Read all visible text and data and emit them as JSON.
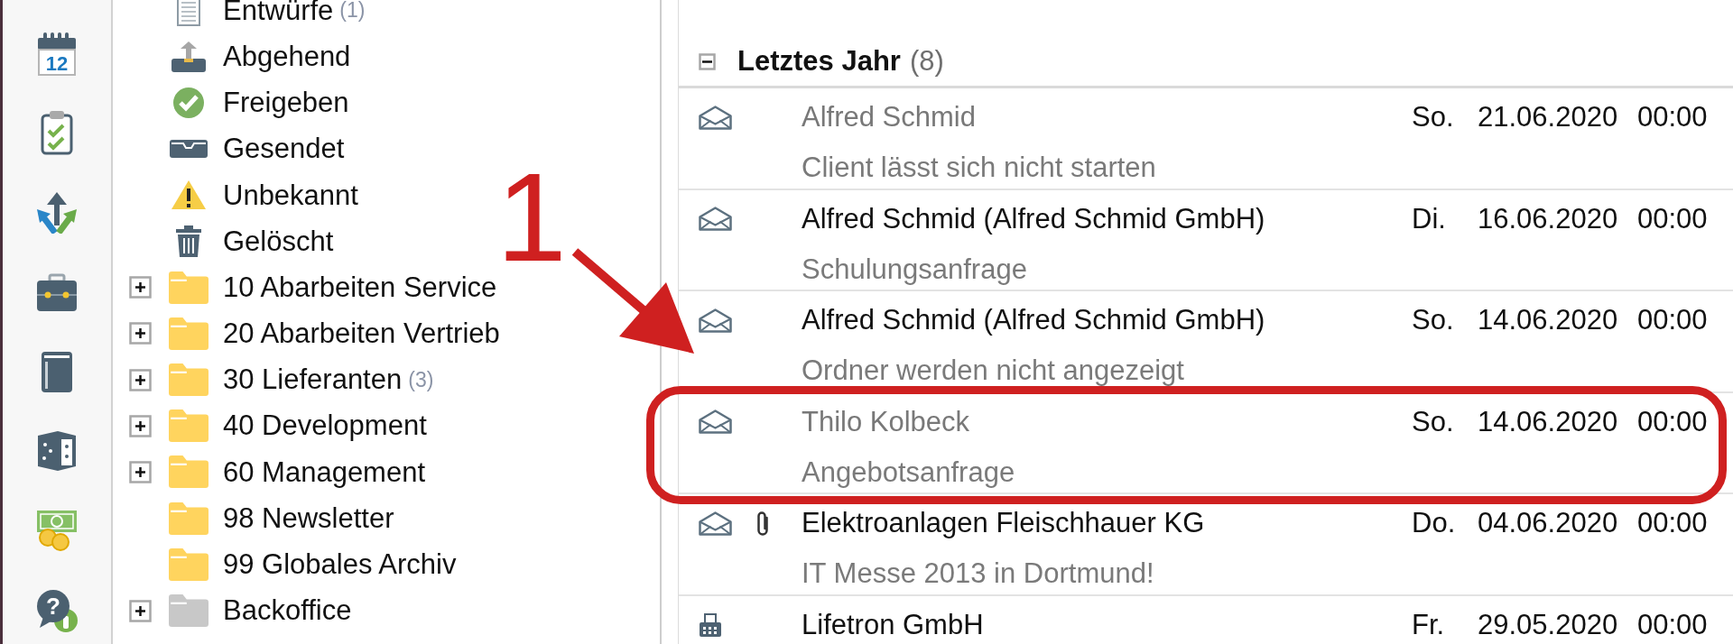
{
  "nav_rail": [
    {
      "kind": "calendar",
      "icon_text": "12"
    },
    {
      "kind": "tasks"
    },
    {
      "kind": "workflow"
    },
    {
      "kind": "briefcase"
    },
    {
      "kind": "book"
    },
    {
      "kind": "door"
    },
    {
      "kind": "money"
    },
    {
      "kind": "help",
      "icon_text": "?"
    }
  ],
  "folder_tree": [
    {
      "kind": "drafts",
      "label": "Entwürfe",
      "count": "(1)"
    },
    {
      "kind": "outbox",
      "label": "Abgehend"
    },
    {
      "kind": "approve",
      "label": "Freigeben"
    },
    {
      "kind": "sent",
      "label": "Gesendet"
    },
    {
      "kind": "unknown",
      "label": "Unbekannt"
    },
    {
      "kind": "trash",
      "label": "Gelöscht"
    },
    {
      "kind": "folder",
      "color": "#ffd45e",
      "label": "10 Abarbeiten Service",
      "expanded": false
    },
    {
      "kind": "folder",
      "color": "#ffd45e",
      "label": "20 Abarbeiten Vertrieb",
      "expanded": false
    },
    {
      "kind": "folder",
      "color": "#ffd45e",
      "label": "30 Lieferanten",
      "count": "(3)",
      "expanded": false
    },
    {
      "kind": "folder",
      "color": "#ffd45e",
      "label": "40 Development",
      "expanded": false
    },
    {
      "kind": "folder",
      "color": "#ffd45e",
      "label": "60 Management",
      "expanded": false
    },
    {
      "kind": "folder",
      "color": "#ffd45e",
      "label": "98 Newsletter"
    },
    {
      "kind": "folder",
      "color": "#ffd45e",
      "label": "99 Globales Archiv"
    },
    {
      "kind": "folder",
      "color": "#c8c8c8",
      "label": "Backoffice",
      "expanded": false
    }
  ],
  "message_list": {
    "group": {
      "label": "Letztes Jahr",
      "count": "(8)",
      "expanded": true
    },
    "messages": [
      {
        "kind": "email",
        "attachment": false,
        "dimmed": true,
        "callout": false,
        "sender": "Alfred Schmid",
        "subject": "Client lässt sich nicht starten",
        "weekday": "So.",
        "date": "21.06.2020",
        "time": "00:00"
      },
      {
        "kind": "email",
        "attachment": false,
        "dimmed": false,
        "callout": false,
        "sender": "Alfred Schmid (Alfred Schmid GmbH)",
        "subject": "Schulungsanfrage",
        "weekday": "Di.",
        "date": "16.06.2020",
        "time": "00:00"
      },
      {
        "kind": "email",
        "attachment": false,
        "dimmed": false,
        "callout": false,
        "sender": "Alfred Schmid (Alfred Schmid GmbH)",
        "subject": "Ordner werden nicht angezeigt",
        "weekday": "So.",
        "date": "14.06.2020",
        "time": "00:00"
      },
      {
        "kind": "email",
        "attachment": false,
        "dimmed": true,
        "callout": true,
        "sender": "Thilo Kolbeck",
        "subject": "Angebotsanfrage",
        "weekday": "So.",
        "date": "14.06.2020",
        "time": "00:00"
      },
      {
        "kind": "email",
        "attachment": true,
        "dimmed": false,
        "callout": false,
        "sender": "Elektroanlagen Fleischhauer KG",
        "subject": "IT Messe 2013 in Dortmund!",
        "weekday": "Do.",
        "date": "04.06.2020",
        "time": "00:00"
      },
      {
        "kind": "fax",
        "attachment": false,
        "dimmed": false,
        "callout": false,
        "sender": "Lifetron GmbH",
        "weekday": "Fr.",
        "date": "29.05.2020",
        "time": "00:00"
      }
    ]
  },
  "annotation": {
    "label": "1"
  }
}
